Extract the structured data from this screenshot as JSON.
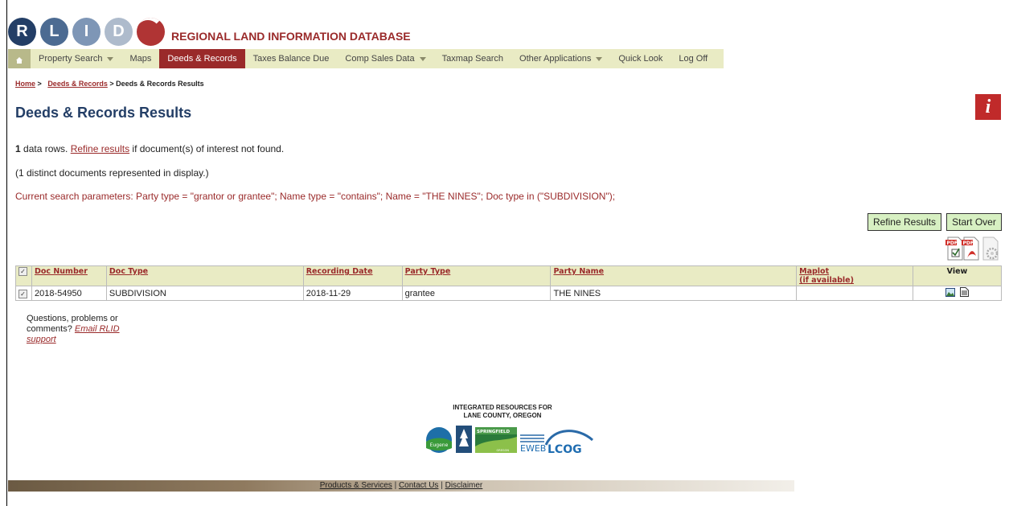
{
  "header": {
    "logo_letters": [
      "R",
      "L",
      "I",
      "D"
    ],
    "title": "REGIONAL LAND INFORMATION DATABASE"
  },
  "nav": {
    "items": [
      {
        "label": "Property Search",
        "has_caret": true
      },
      {
        "label": "Maps",
        "has_caret": false
      },
      {
        "label": "Deeds & Records",
        "has_caret": false,
        "active": true
      },
      {
        "label": "Taxes Balance Due",
        "has_caret": false
      },
      {
        "label": "Comp Sales Data",
        "has_caret": true
      },
      {
        "label": "Taxmap Search",
        "has_caret": false
      },
      {
        "label": "Other Applications",
        "has_caret": true
      },
      {
        "label": "Quick Look",
        "has_caret": false
      },
      {
        "label": "Log Off",
        "has_caret": false
      }
    ]
  },
  "breadcrumb": {
    "home": "Home",
    "sep": ">",
    "section": "Deeds & Records",
    "current": "> Deeds & Records Results"
  },
  "page": {
    "title": "Deeds & Records Results",
    "info_icon": "i",
    "rows_count": "1",
    "rows_text": " data rows. ",
    "refine_link": "Refine results",
    "rows_suffix": " if document(s) of interest not found.",
    "distinct_text": "(1 distinct documents represented in display.)",
    "params_text": "Current search parameters: Party type = \"grantor or grantee\"; Name type = \"contains\"; Name = \"THE NINES\"; Doc type in (\"SUBDIVISION\");"
  },
  "buttons": {
    "refine": "Refine Results",
    "start_over": "Start Over"
  },
  "tool_icons": [
    "pdf-checked-icon",
    "pdf-icon",
    "settings-gear-icon"
  ],
  "table": {
    "columns": [
      {
        "label": "Doc Number"
      },
      {
        "label": "Doc Type"
      },
      {
        "label": "Recording Date"
      },
      {
        "label": "Party Type"
      },
      {
        "label": "Party Name"
      },
      {
        "label": "Maplot",
        "sub": "(if available)"
      },
      {
        "label": "View"
      }
    ],
    "rows": [
      {
        "doc_number": "2018-54950",
        "doc_type": "SUBDIVISION",
        "recording_date": "2018-11-29",
        "party_type": "grantee",
        "party_name": "THE NINES",
        "maplot": ""
      }
    ]
  },
  "support": {
    "text": "Questions, problems or comments? ",
    "link": "Email RLID support"
  },
  "footer": {
    "org_line1": "INTEGRATED RESOURCES FOR",
    "org_line2": "LANE COUNTY, OREGON",
    "partner_labels": [
      "Eugene",
      "SPRINGFIELD",
      "OREGON",
      "EWEB",
      "LCOG"
    ],
    "links": [
      "Products & Services",
      "Contact Us",
      "Disclaimer"
    ],
    "link_sep": "|"
  },
  "colors": {
    "brand_red": "#9a2a2a",
    "nav_bg": "#e9ebc4",
    "title_blue": "#233e66",
    "button_bg": "#d7f0c2"
  }
}
